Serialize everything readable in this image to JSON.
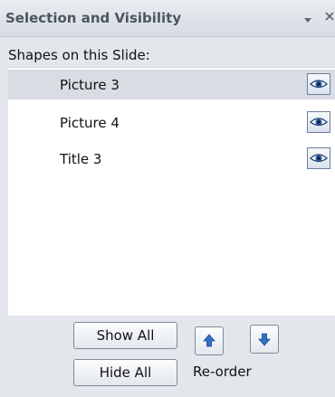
{
  "pane": {
    "title": "Selection and Visibility",
    "subtitle": "Shapes on this Slide:"
  },
  "shapes": [
    {
      "label": "Picture 3",
      "selected": true,
      "visible": true
    },
    {
      "label": "Picture 4",
      "selected": false,
      "visible": true
    },
    {
      "label": "Title 3",
      "selected": false,
      "visible": true
    }
  ],
  "buttons": {
    "show_all": "Show All",
    "hide_all": "Hide All",
    "reorder_label": "Re-order"
  },
  "icons": {
    "visibility": "eye-icon",
    "move_up": "arrow-up-icon",
    "move_down": "arrow-down-icon",
    "dropdown": "dropdown-arrow-icon",
    "close": "close-icon"
  },
  "colors": {
    "selected_row": "#d9dde3",
    "arrow_blue": "#2f6fc7"
  }
}
